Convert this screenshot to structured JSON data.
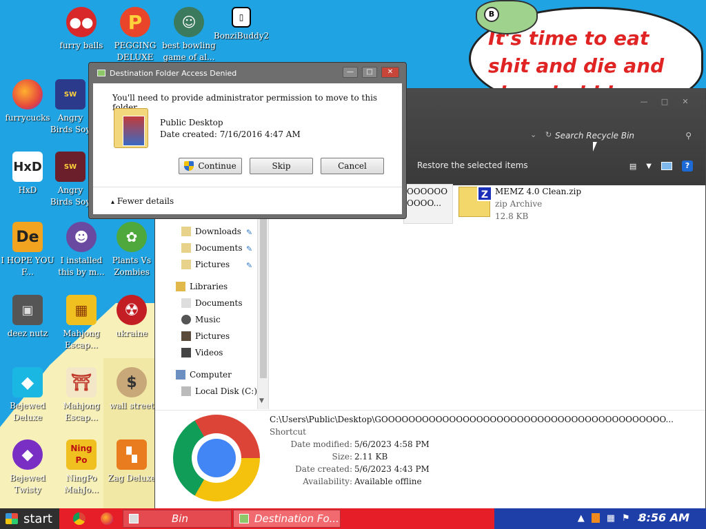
{
  "wallpaper": {
    "bubble_text": "It's time to eat shit and die and chew bubble gum",
    "frog_letter": "B"
  },
  "desktop_icons": [
    {
      "label": "furry balls"
    },
    {
      "label": "PEGGING DELUXE"
    },
    {
      "label": "best bowling game of al..."
    },
    {
      "label": "BonziBuddy2"
    },
    {
      "label": "furrycucks"
    },
    {
      "label": "Angry Birds Soy Wars"
    },
    {
      "label": "HxD"
    },
    {
      "label": "Angry Birds Soy Wars"
    },
    {
      "label": "I HOPE YOU F..."
    },
    {
      "label": "I installed this by m..."
    },
    {
      "label": "Plants Vs Zombies"
    },
    {
      "label": "deez nutz"
    },
    {
      "label": "Mahjong Escap..."
    },
    {
      "label": "ukraine"
    },
    {
      "label": "Bejewed Deluxe"
    },
    {
      "label": "Mahjong Escap..."
    },
    {
      "label": "wall street"
    },
    {
      "label": "Bejewed Twisty"
    },
    {
      "label": "NingPo MahJo..."
    },
    {
      "label": "Zag Deluxe"
    }
  ],
  "explorer": {
    "search_placeholder": "Search Recycle Bin",
    "toolbar_restore": "Restore the selected items",
    "nav": {
      "downloads": "Downloads",
      "documents": "Documents",
      "pictures": "Pictures",
      "libraries": "Libraries",
      "lib_documents": "Documents",
      "lib_music": "Music",
      "lib_pictures": "Pictures",
      "lib_videos": "Videos",
      "computer": "Computer",
      "local_disk": "Local Disk (C:)"
    },
    "goo_tile_text": "OOOOOO OOOO...",
    "file": {
      "name": "MEMZ 4.0 Clean.zip",
      "type": "zip Archive",
      "size": "12.8 KB"
    },
    "details": {
      "path": "C:\\Users\\Public\\Desktop\\GOOOOOOOOOOOOOOOOOOOOOOOOOOOOOOOOOOOOOOOOOO...",
      "type": "Shortcut",
      "rows": [
        {
          "key": "Date modified:",
          "value": "5/6/2023 4:58 PM"
        },
        {
          "key": "Size:",
          "value": "2.11 KB"
        },
        {
          "key": "Date created:",
          "value": "5/6/2023 4:43 PM"
        },
        {
          "key": "Availability:",
          "value": "Available offline"
        }
      ]
    }
  },
  "dialog": {
    "title": "Destination Folder Access Denied",
    "message": "You'll need to provide administrator permission to move to this folder",
    "item_name": "Public Desktop",
    "item_date": "Date created: 7/16/2016 4:47 AM",
    "continue_label": "Continue",
    "skip_label": "Skip",
    "cancel_label": "Cancel",
    "fewer_details": "Fewer details"
  },
  "taskbar": {
    "start_label": "start",
    "task1": "Bin",
    "task2": "Destination Fo...",
    "clock": "8:56 AM"
  },
  "colors": {
    "desktop_bg": "#1fa3e3",
    "taskbar_red": "#e61e28",
    "taskbar_blue": "#1e3fa8",
    "bubble_text": "#e02424"
  }
}
